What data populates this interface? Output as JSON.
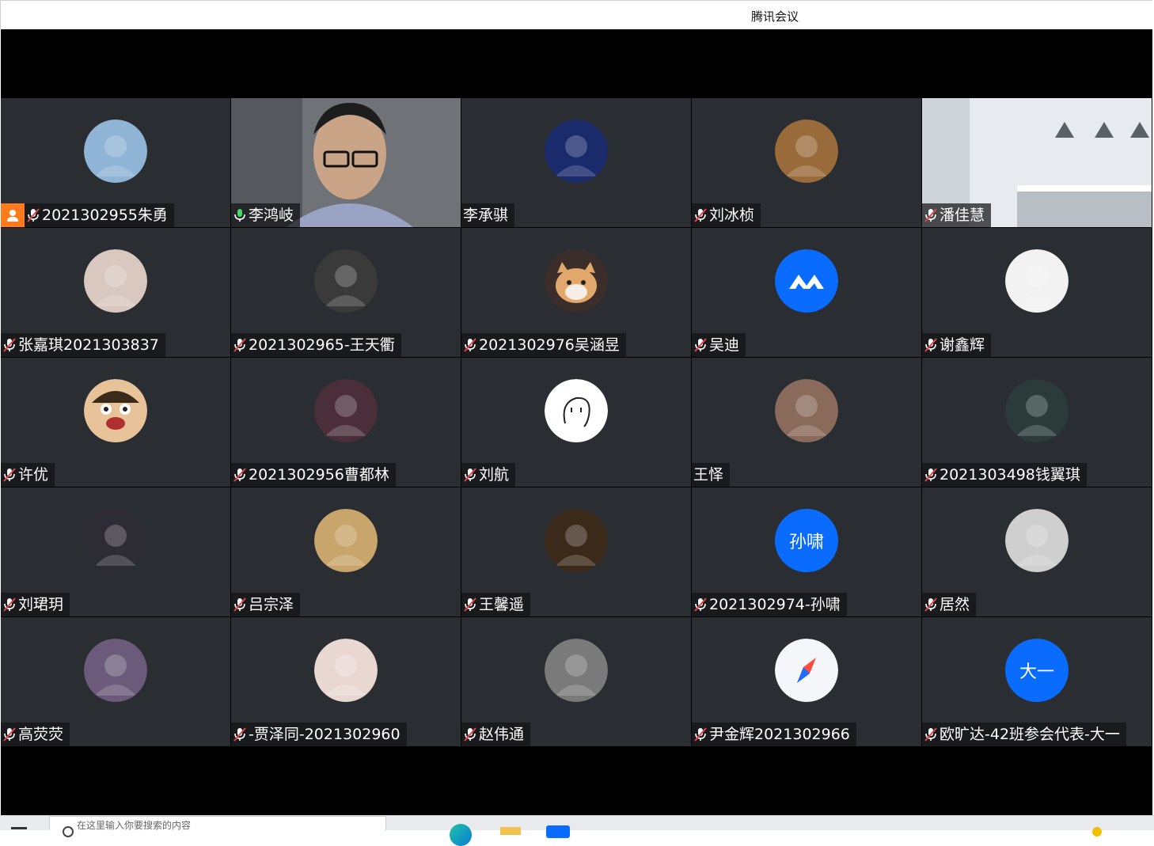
{
  "window": {
    "title": "腾讯会议"
  },
  "participants": [
    {
      "name": "2021302955朱勇",
      "muted": true,
      "host": true,
      "avatar": "anime-boy-avatar",
      "avatar_color": "#8fb4d6"
    },
    {
      "name": "李鸿岐",
      "muted": false,
      "active_speaker": true,
      "video": "person",
      "avatar": "camera-video"
    },
    {
      "name": "李承骐",
      "muted": null,
      "avatar": "galaxy-tower-avatar",
      "avatar_color": "#1a2a6b"
    },
    {
      "name": "刘冰桢",
      "muted": true,
      "avatar": "muscle-character-avatar",
      "avatar_color": "#9a6b3a"
    },
    {
      "name": "潘佳慧",
      "muted": true,
      "video": "room",
      "avatar": "virtual-background"
    },
    {
      "name": "张嘉琪2021303837",
      "muted": true,
      "avatar": "sketch-girl-avatar",
      "avatar_color": "#d8c8bf"
    },
    {
      "name": "2021302965-王天衢",
      "muted": true,
      "avatar": "masked-character-avatar",
      "avatar_color": "#3a3a3a"
    },
    {
      "name": "2021302976吴涵昱",
      "muted": true,
      "avatar": "cat-avatar",
      "avatar_color": "#e2a76a"
    },
    {
      "name": "吴迪",
      "muted": true,
      "avatar": "tencent-meeting-logo-avatar",
      "avatar_color": "#0a6cff"
    },
    {
      "name": "谢鑫辉",
      "muted": true,
      "avatar": "manga-sketch-avatar",
      "avatar_color": "#f2f2f2"
    },
    {
      "name": "许优",
      "muted": true,
      "avatar": "cartoon-face-avatar",
      "avatar_color": "#e8c39a"
    },
    {
      "name": "2021302956曹都林",
      "muted": true,
      "avatar": "white-hair-anime-avatar",
      "avatar_color": "#4a2f3a"
    },
    {
      "name": "刘航",
      "muted": true,
      "avatar": "doodle-face-avatar",
      "avatar_color": "#ffffff"
    },
    {
      "name": "王怿",
      "muted": null,
      "avatar": "mirror-selfie-avatar",
      "avatar_color": "#8a6a5a"
    },
    {
      "name": "2021303498钱翼琪",
      "muted": true,
      "avatar": "dark-anime-avatar",
      "avatar_color": "#2a3b3a"
    },
    {
      "name": "刘珺玥",
      "muted": true,
      "avatar": "dark-hair-anime-avatar",
      "avatar_color": "#2d2b33"
    },
    {
      "name": "吕宗泽",
      "muted": true,
      "avatar": "masked-person-avatar",
      "avatar_color": "#c8a56a"
    },
    {
      "name": "王馨遥",
      "muted": true,
      "avatar": "child-photo-avatar",
      "avatar_color": "#3b2a1a"
    },
    {
      "name": "2021302974-孙啸",
      "muted": true,
      "avatar": "text-avatar",
      "avatar_text": "孙啸",
      "avatar_color": "#0a6cff"
    },
    {
      "name": "居然",
      "muted": true,
      "avatar": "portrait-bw-avatar",
      "avatar_color": "#cfcfcf"
    },
    {
      "name": "高荧荧",
      "muted": true,
      "avatar": "fantasy-character-avatar",
      "avatar_color": "#6b5a7a"
    },
    {
      "name": "-贾泽同-2021302960",
      "muted": true,
      "avatar": "boy-sketch-avatar",
      "avatar_color": "#e9d8d2"
    },
    {
      "name": "赵伟通",
      "muted": true,
      "avatar": "ink-portrait-avatar",
      "avatar_color": "#7a7a7a"
    },
    {
      "name": "尹金辉2021302966",
      "muted": true,
      "avatar": "compass-avatar",
      "avatar_color": "#ffffff"
    },
    {
      "name": "欧旷达-42班参会代表-大一",
      "muted": true,
      "avatar": "text-avatar",
      "avatar_text": "大一",
      "avatar_color": "#0a6cff"
    }
  ],
  "taskbar": {
    "search_placeholder": "在这里输入你要搜索的内容"
  },
  "colors": {
    "tile_bg": "#2a2d31",
    "active_border": "#2fcf6a",
    "muted_mic": "#e04848",
    "host_badge": "#ff7a1a"
  }
}
